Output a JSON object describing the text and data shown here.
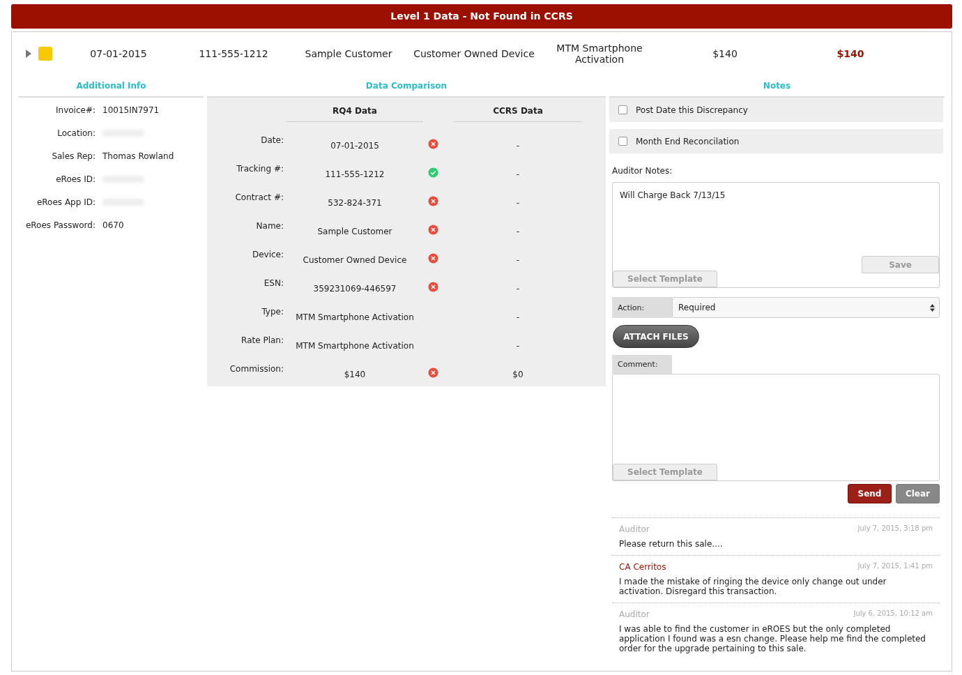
{
  "header": {
    "title": "Level 1 Data - Not Found in CCRS"
  },
  "summary": {
    "expanded": false,
    "color": "#f8c800",
    "cells": [
      "07-01-2015",
      "111-555-1212",
      "Sample Customer",
      "Customer Owned Device",
      "MTM Smartphone Activation",
      "$140"
    ],
    "highlight": "$140"
  },
  "additional_info": {
    "title": "Additional Info",
    "fields": [
      {
        "label": "Invoice#:",
        "value": "10015IN7971",
        "redacted": false
      },
      {
        "label": "Location:",
        "redacted": true
      },
      {
        "label": "Sales Rep:",
        "value": "Thomas Rowland",
        "redacted": false
      },
      {
        "label": "eRoes ID:",
        "redacted": true
      },
      {
        "label": "eRoes App ID:",
        "redacted": true
      },
      {
        "label": "eRoes Password:",
        "value": "0670",
        "redacted": false
      }
    ]
  },
  "comparison": {
    "title": "Data Comparison",
    "columns": [
      "RQ4 Data",
      "CCRS Data"
    ],
    "rows": [
      {
        "label": "Date:",
        "rq4": "07-01-2015",
        "kind": "mismatch",
        "ccrs": "-"
      },
      {
        "label": "Tracking #:",
        "rq4": "111-555-1212",
        "kind": "match",
        "ccrs": "-"
      },
      {
        "label": "Contract #:",
        "rq4": "532-824-371",
        "kind": "mismatch",
        "ccrs": "-"
      },
      {
        "label": "Name:",
        "rq4": "Sample Customer",
        "kind": "mismatch",
        "ccrs": "-"
      },
      {
        "label": "Device:",
        "rq4": "Customer Owned Device",
        "kind": "mismatch",
        "ccrs": "-"
      },
      {
        "label": "ESN:",
        "rq4": "359231069-446597",
        "kind": "mismatch",
        "ccrs": "-"
      },
      {
        "label": "Type:",
        "rq4": "MTM Smartphone Activation",
        "kind": "plain",
        "ccrs": "-"
      },
      {
        "label": "Rate Plan:",
        "rq4": "MTM Smartphone Activation",
        "kind": "plain",
        "ccrs": "-"
      },
      {
        "label": "Commission:",
        "rq4": "$140",
        "kind": "mismatch",
        "ccrs": "$0"
      }
    ]
  },
  "notes": {
    "title": "Notes",
    "options": [
      {
        "label": "Post Date this Discrepancy",
        "checked": false
      },
      {
        "label": "Month End Reconcilation",
        "checked": false
      }
    ],
    "auditor_notes": {
      "label": "Auditor Notes:",
      "value": "Will Charge Back 7/13/15",
      "save": "Save",
      "template": "Select Template"
    },
    "action": {
      "label": "Action:",
      "value": "Required"
    },
    "attach": "ATTACH FILES",
    "comment": {
      "label": "Comment:",
      "template": "Select Template"
    },
    "buttons": {
      "send": "Send",
      "clear": "Clear"
    },
    "messages": [
      {
        "author": "Auditor",
        "kind": "auditor",
        "time": "July 7, 2015, 3:18 pm",
        "text": "Please return this sale...."
      },
      {
        "author": "CA Cerritos",
        "kind": "store",
        "time": "July 7, 2015, 1:41 pm",
        "text": "I made the mistake of ringing the device only change out under activation. Disregard this transaction."
      },
      {
        "author": "Auditor",
        "kind": "auditor",
        "time": "July 6, 2015, 10:12 am",
        "text": "I was able to find the customer in eROES but the only completed application I found was a esn change. Please help me find the completed order for the upgrade pertaining to this sale."
      }
    ]
  }
}
